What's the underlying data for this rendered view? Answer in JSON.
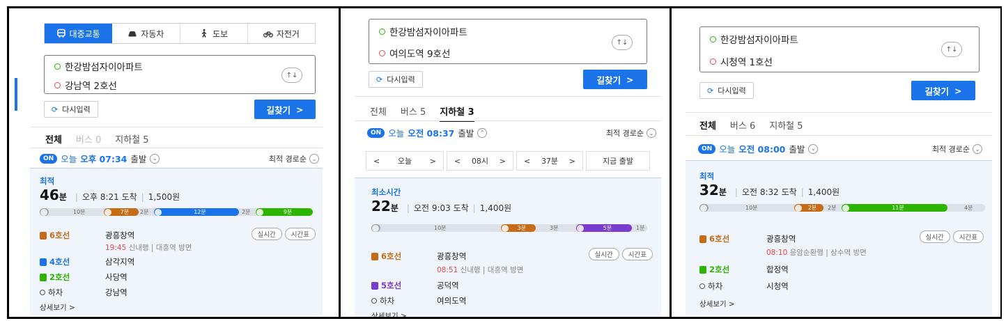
{
  "panels": [
    {
      "modes": [
        {
          "label": "대중교통",
          "icon": "bus-icon",
          "active": true
        },
        {
          "label": "자동차",
          "icon": "car-icon",
          "active": false
        },
        {
          "label": "도보",
          "icon": "walk-icon",
          "active": false
        },
        {
          "label": "자전거",
          "icon": "bike-icon",
          "active": false
        }
      ],
      "origin": "한강밤섬자이아파트",
      "destination": "강남역 2호선",
      "swap": "↑↓",
      "reset_label": "다시입력",
      "search_label": "길찾기",
      "search_arrow": ">",
      "tabs": [
        {
          "label": "전체"
        },
        {
          "label": "버스 0"
        },
        {
          "label": "지하철 5"
        }
      ],
      "on": "ON",
      "day": "오늘",
      "time": "오후 07:34",
      "depart": "출발",
      "sort_label": "최적 경로순",
      "route": {
        "label": "최적",
        "minutes": "46",
        "minute_unit": "분",
        "arrival": "오후 8:21 도착",
        "fare": "1,500원",
        "segments": [
          {
            "type": "walk",
            "text": "10분"
          },
          {
            "type": "l6",
            "text": "7분"
          },
          {
            "type": "gap",
            "text": "2분"
          },
          {
            "type": "l4",
            "text": "12분"
          },
          {
            "type": "gap",
            "text": "2분"
          },
          {
            "type": "l2",
            "text": "9분"
          }
        ],
        "steps": [
          {
            "line": "6호선",
            "station": "광흥창역"
          },
          {
            "line": "4호선",
            "station": "삼각지역"
          },
          {
            "line": "2호선",
            "station": "사당역"
          },
          {
            "line": "하차",
            "station": "강남역"
          }
        ],
        "realtime": "실시간",
        "timetable": "시간표",
        "eta_time": "19:45",
        "eta_text": "신내행 | 대흥역 방면",
        "more": "상세보기 >"
      }
    },
    {
      "origin": "한강밤섬자이아파트",
      "destination": "여의도역 9호선",
      "swap": "↑↓",
      "reset_label": "다시입력",
      "search_label": "길찾기",
      "search_arrow": ">",
      "tabs": [
        {
          "label": "전체"
        },
        {
          "label": "버스 5"
        },
        {
          "label": "지하철 3"
        }
      ],
      "on": "ON",
      "day": "오늘",
      "time": "오전 08:37",
      "depart": "출발",
      "sort_label": "최적 경로순",
      "time_select": {
        "day": "오늘",
        "hour": "08시",
        "minute": "37분",
        "now": "지금 출발",
        "prev": "<",
        "next": ">"
      },
      "route": {
        "label": "최소시간",
        "minutes": "22",
        "minute_unit": "분",
        "arrival": "오전 9:03 도착",
        "fare": "1,400원",
        "segments": [
          {
            "type": "walk",
            "text": "10분"
          },
          {
            "type": "l6",
            "text": "3분"
          },
          {
            "type": "gap",
            "text": "3분"
          },
          {
            "type": "l5",
            "text": "5분"
          },
          {
            "type": "gap",
            "text": "1분"
          }
        ],
        "steps": [
          {
            "line": "6호선",
            "station": "광흥창역"
          },
          {
            "line": "5호선",
            "station": "공덕역"
          },
          {
            "line": "하차",
            "station": "여의도역"
          }
        ],
        "realtime": "실시간",
        "timetable": "시간표",
        "eta_time": "08:51",
        "eta_text": "신내행 | 대흥역 방면",
        "more": "상세보기 >"
      }
    },
    {
      "origin": "한강밤섬자이아파트",
      "destination": "시청역 1호선",
      "swap": "↑↓",
      "reset_label": "다시입력",
      "search_label": "길찾기",
      "search_arrow": ">",
      "tabs": [
        {
          "label": "전체"
        },
        {
          "label": "버스 6"
        },
        {
          "label": "지하철 5"
        }
      ],
      "on": "ON",
      "day": "오늘",
      "time": "오전 08:00",
      "depart": "출발",
      "sort_label": "최적 경로순",
      "route": {
        "label": "최적",
        "minutes": "32",
        "minute_unit": "분",
        "arrival": "오전 8:32 도착",
        "fare": "1,400원",
        "segments": [
          {
            "type": "walk",
            "text": "10분"
          },
          {
            "type": "l6",
            "text": "2분"
          },
          {
            "type": "gap",
            "text": "2분"
          },
          {
            "type": "l2",
            "text": "11분"
          },
          {
            "type": "gap",
            "text": "4분"
          }
        ],
        "steps": [
          {
            "line": "6호선",
            "station": "광흥창역"
          },
          {
            "line": "2호선",
            "station": "합정역"
          },
          {
            "line": "하차",
            "station": "시청역"
          }
        ],
        "realtime": "실시간",
        "timetable": "시간표",
        "eta_time": "08:10",
        "eta_text": "응암순환행 | 상수역 방면",
        "more": "상세보기 >"
      }
    }
  ],
  "colors": {
    "accent": "#1a73e8",
    "line6": "#c66b16",
    "line4": "#1a73e8",
    "line2": "#2db400",
    "line5": "#7a3bd1"
  }
}
